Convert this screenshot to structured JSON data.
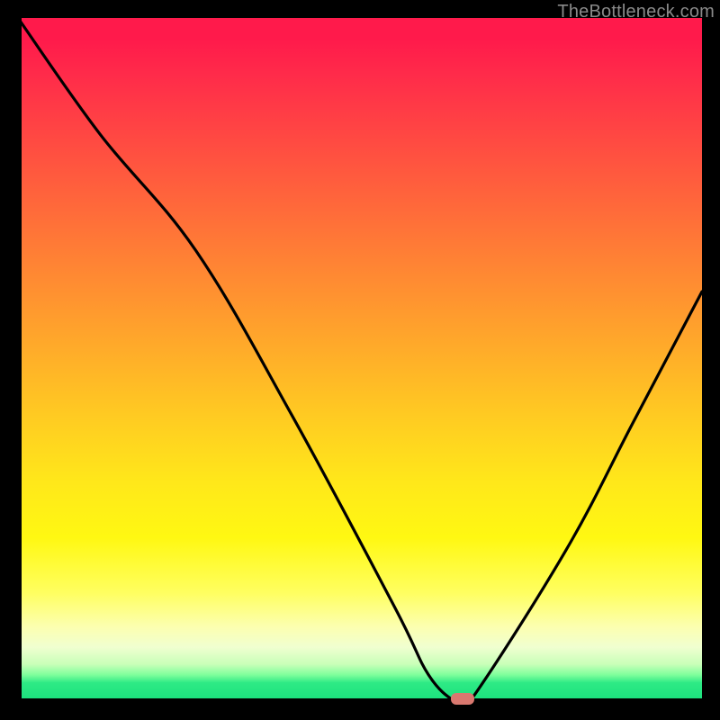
{
  "watermark": "TheBottleneck.com",
  "chart_data": {
    "type": "line",
    "title": "",
    "xlabel": "",
    "ylabel": "",
    "xlim": [
      0,
      100
    ],
    "ylim": [
      0,
      100
    ],
    "grid": false,
    "legend": false,
    "series": [
      {
        "name": "bottleneck-curve",
        "x": [
          0,
          12,
          26,
          40,
          55,
          60,
          64,
          66,
          80,
          90,
          100
        ],
        "values": [
          100,
          83,
          66,
          42,
          14,
          4,
          0,
          0,
          22,
          41,
          60
        ]
      }
    ],
    "marker": {
      "name": "highlight-marker",
      "x": 65,
      "y": 0,
      "color": "#d9786f"
    }
  }
}
